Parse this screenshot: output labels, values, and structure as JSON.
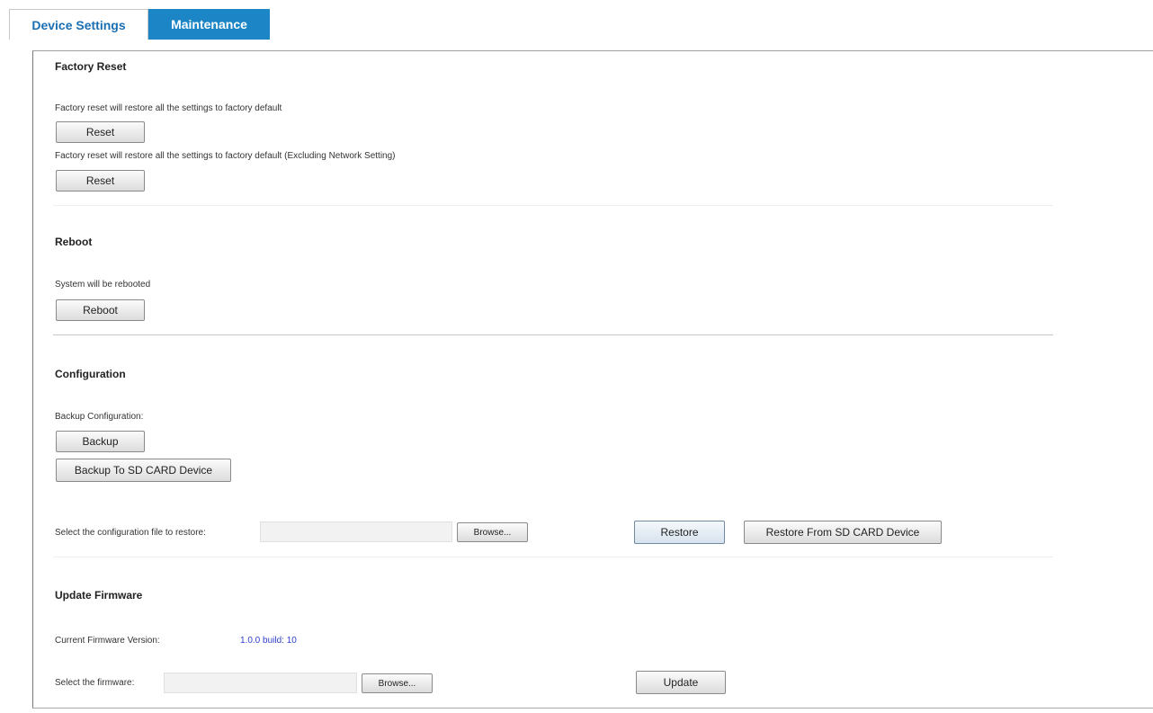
{
  "tabs": [
    {
      "label": "Device Settings",
      "active": false
    },
    {
      "label": "Maintenance",
      "active": true
    }
  ],
  "factory_reset": {
    "heading": "Factory Reset",
    "desc1": "Factory reset will restore all the settings to factory default",
    "reset1_label": "Reset",
    "desc2": "Factory reset will restore all the settings to factory default (Excluding Network Setting)",
    "reset2_label": "Reset"
  },
  "reboot": {
    "heading": "Reboot",
    "desc": "System will be rebooted",
    "button_label": "Reboot"
  },
  "configuration": {
    "heading": "Configuration",
    "backup_label": "Backup Configuration:",
    "backup_button": "Backup",
    "backup_sd_button": "Backup To SD CARD Device",
    "restore_prompt": "Select the configuration file to restore:",
    "file_value": "",
    "browse_label": "Browse...",
    "restore_button": "Restore",
    "restore_sd_button": "Restore From SD CARD Device"
  },
  "firmware": {
    "heading": "Update Firmware",
    "version_label": "Current Firmware Version:",
    "version_value": "1.0.0 build: 10",
    "select_prompt": "Select the firmware:",
    "file_value": "",
    "browse_label": "Browse...",
    "update_button": "Update"
  },
  "colors": {
    "tab_active_bg": "#1b85c5",
    "tab_inactive_text": "#1a6fb3",
    "version_text": "#2c3ec9"
  }
}
